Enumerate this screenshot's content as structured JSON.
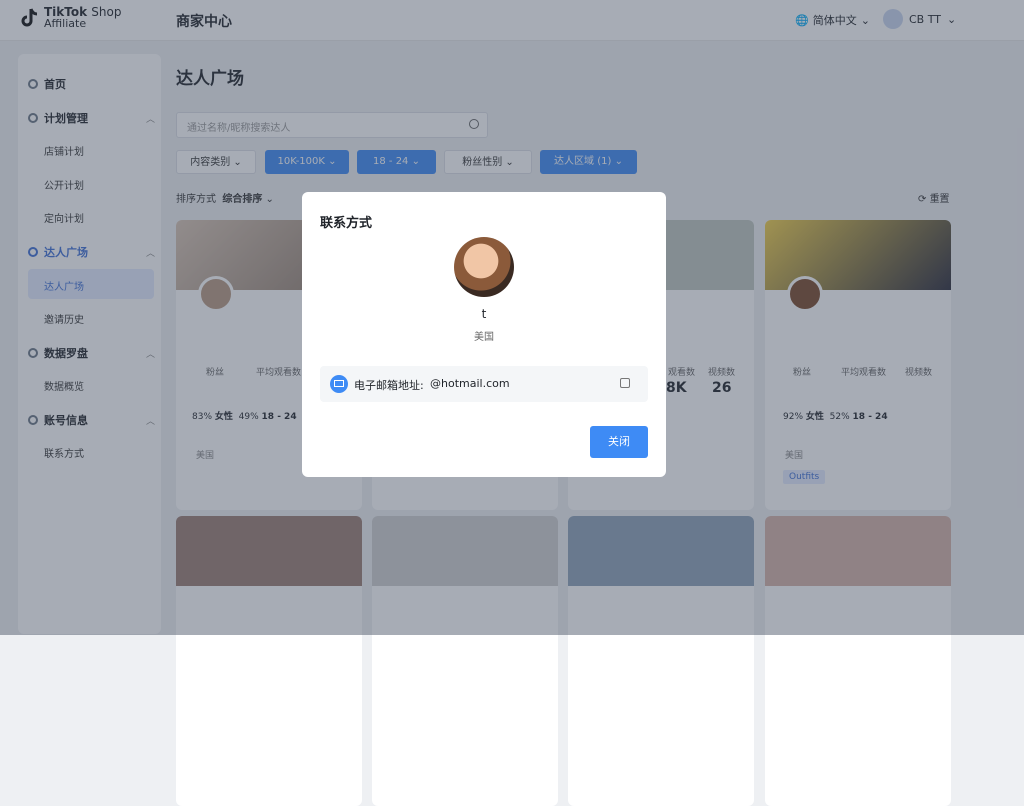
{
  "header": {
    "logo_brand": "TikTok",
    "logo_shop": "Shop",
    "logo_affiliate": "Affiliate",
    "title": "商家中心",
    "language": "简体中文",
    "user": "CB TT"
  },
  "sidebar": {
    "home": "首页",
    "plan_mgmt": "计划管理",
    "store_plan": "店铺计划",
    "public_plan": "公开计划",
    "targeted_plan": "定向计划",
    "creator_square": "达人广场",
    "creator_square_sub": "达人广场",
    "invite_history": "邀请历史",
    "data_compass": "数据罗盘",
    "data_overview": "数据概览",
    "account_info": "账号信息",
    "contact_info": "联系方式"
  },
  "main": {
    "title": "达人广场",
    "search_placeholder": "通过名称/昵称搜索达人",
    "sort_label": "排序方式",
    "sort_value": "综合排序",
    "reset": "重置"
  },
  "filters": {
    "content_category": "内容类别",
    "followers": "10K-100K",
    "age": "18 - 24",
    "fan_gender": "粉丝性别",
    "region": "达人区域 (1)"
  },
  "cards": [
    {
      "label_followers": "粉丝",
      "label_avg_views": "平均观看数",
      "pct_female": "83%",
      "female": "女性",
      "pct_age": "49%",
      "age": "18 - 24",
      "location": "美国"
    },
    {
      "label_followers": "粉丝",
      "label_avg_views": "平均观看数",
      "label_videos": "视频数",
      "pct_female": "92%",
      "female": "女性",
      "pct_age": "52%",
      "age": "18 - 24",
      "location": "美国",
      "tag": "Outfits"
    }
  ],
  "card_visible": {
    "views": "8K",
    "videos": "26",
    "videos_label": "视频数",
    "avg_label": "观看数"
  },
  "modal": {
    "title": "联系方式",
    "name": "t",
    "location": "美国",
    "email_label": "电子邮箱地址:",
    "email": "@hotmail.com",
    "close": "关闭"
  }
}
